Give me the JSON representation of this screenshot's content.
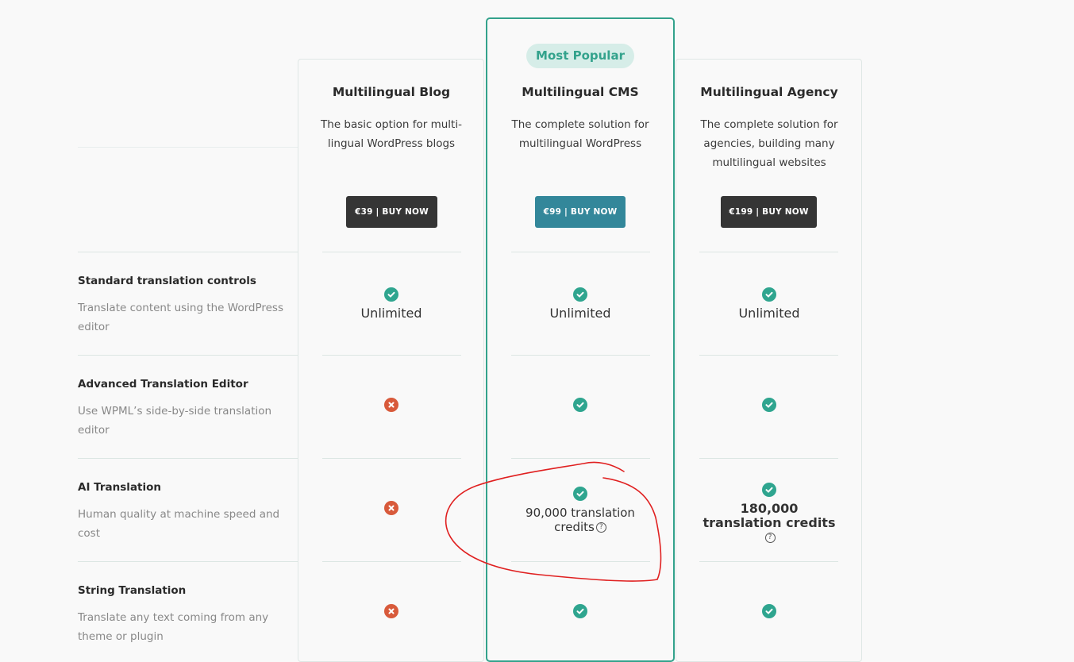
{
  "badge": "Most Popular",
  "plans": [
    {
      "title": "Multilingual Blog",
      "desc": "The basic option for multi-lingual WordPress blogs",
      "button": "€39 | BUY NOW"
    },
    {
      "title": "Multilingual CMS",
      "desc": "The complete solution for multilingual WordPress",
      "button": "€99 | BUY NOW"
    },
    {
      "title": "Multilingual Agency",
      "desc": "The complete solution for agencies, building many multilingual websites",
      "button": "€199 | BUY NOW"
    }
  ],
  "features": [
    {
      "title": "Standard translation controls",
      "desc": "Translate content using the WordPress editor",
      "cells": [
        {
          "status": "check",
          "text": "Unlimited"
        },
        {
          "status": "check",
          "text": "Unlimited"
        },
        {
          "status": "check",
          "text": "Unlimited"
        }
      ]
    },
    {
      "title": "Advanced Translation Editor",
      "desc": "Use WPML’s side-by-side translation editor",
      "cells": [
        {
          "status": "cross"
        },
        {
          "status": "check"
        },
        {
          "status": "check"
        }
      ]
    },
    {
      "title": "AI Translation",
      "desc": "Human quality at machine speed and cost",
      "cells": [
        {
          "status": "cross"
        },
        {
          "status": "check",
          "text": "90,000 translation credits"
        },
        {
          "status": "check",
          "text": "180,000 translation credits"
        }
      ]
    },
    {
      "title": "String Translation",
      "desc": "Translate any text coming from any theme or plugin",
      "cells": [
        {
          "status": "cross"
        },
        {
          "status": "check"
        },
        {
          "status": "check"
        }
      ]
    }
  ],
  "help_icon": "question-circle-icon",
  "colors": {
    "accent": "#33a28c",
    "check": "#2fa58f",
    "cross": "#d85a3b",
    "cms_button": "#33879a",
    "dark_button": "#353535",
    "annotation": "#e02020"
  }
}
